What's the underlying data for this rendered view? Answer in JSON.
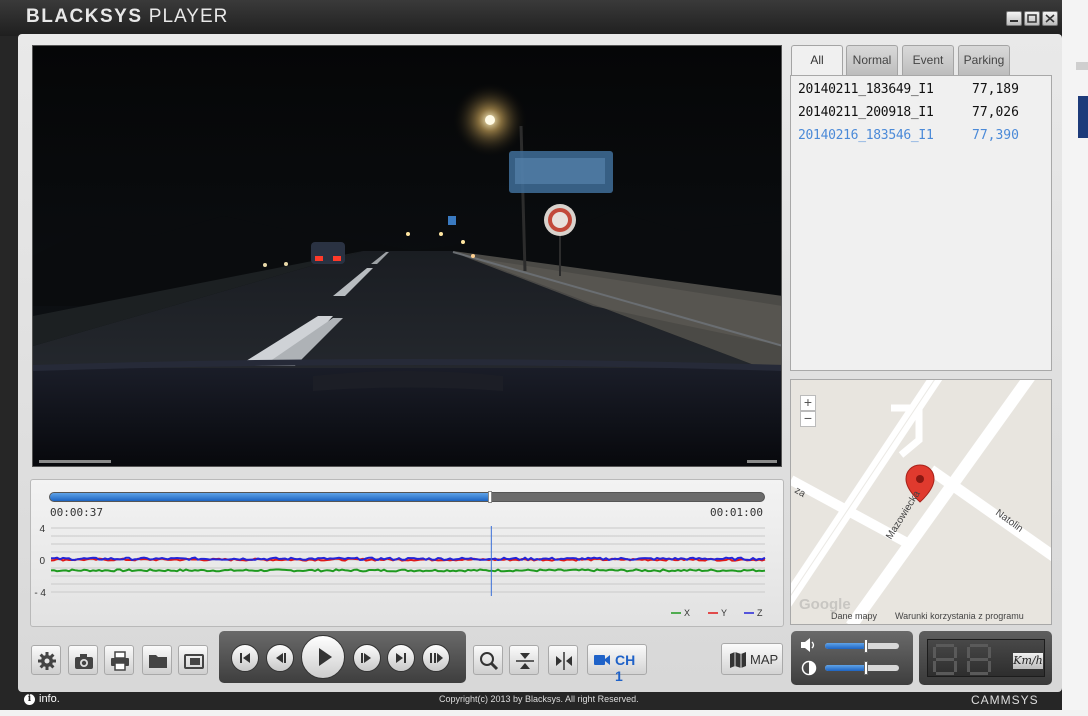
{
  "window": {
    "title_bold": "BLACKSYS",
    "title_light": "PLAYER",
    "controls": [
      "minimize",
      "maximize",
      "close"
    ]
  },
  "playback": {
    "current_time": "00:00:37",
    "end_time": "00:01:00",
    "progress": 0.6167
  },
  "gsensor": {
    "y_ticks": [
      "4",
      "0",
      "- 4"
    ],
    "legend": [
      {
        "label": "X",
        "color": "#1f9a1f"
      },
      {
        "label": "Y",
        "color": "#e01818"
      },
      {
        "label": "Z",
        "color": "#2424d8"
      }
    ],
    "x_level": -1.3,
    "y_level": 0.05,
    "z_level": 0.15,
    "y_range": [
      -4,
      4
    ]
  },
  "tabs": [
    {
      "label": "All",
      "active": true
    },
    {
      "label": "Normal",
      "active": false
    },
    {
      "label": "Event",
      "active": false
    },
    {
      "label": "Parking",
      "active": false
    }
  ],
  "files": [
    {
      "name": "20140211_183649_I1",
      "size": "77,189",
      "selected": false
    },
    {
      "name": "20140211_200918_I1",
      "size": "77,026",
      "selected": false
    },
    {
      "name": "20140216_183546_I1",
      "size": "77,390",
      "selected": true
    }
  ],
  "map": {
    "zoom_in": "+",
    "zoom_out": "−",
    "streets": [
      "Mazowiecka",
      "Natolin",
      "za"
    ],
    "attribution_logo": "Google",
    "attribution_data": "Dane mapy",
    "attribution_terms": "Warunki korzystania z programu"
  },
  "toolbar": {
    "tools": [
      "settings",
      "snapshot",
      "print",
      "open-folder",
      "export"
    ],
    "transport": [
      "skip-previous",
      "step-back",
      "play",
      "step-forward",
      "skip-next",
      "pause"
    ],
    "view_tools": [
      "zoom",
      "flip-vertical",
      "flip-horizontal"
    ],
    "channel_label": "CH 1",
    "map_label": "MAP"
  },
  "volume_level": 0.55,
  "brightness_level": 0.55,
  "speed": {
    "digits": "",
    "unit": "Km/h"
  },
  "status": {
    "info_label": "info.",
    "copyright": "Copyright(c) 2013 by Blacksys. All right Reserved.",
    "brand": "CAMMSYS"
  },
  "colors": {
    "accent": "#1d64c2",
    "selected_file": "#4b8ad8",
    "route_marker": "#e03a2e"
  }
}
